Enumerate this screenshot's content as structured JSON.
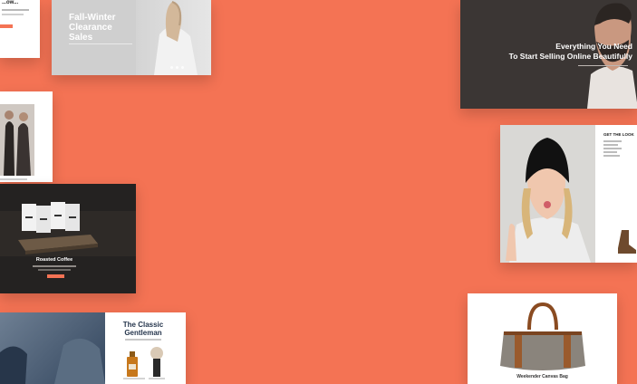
{
  "theme": {
    "background": "#f47354",
    "accent": "#f47354"
  },
  "cards": {
    "topleft": {
      "title": "...ow..."
    },
    "fallwinter": {
      "title": "Fall-Winter Clearance Sales"
    },
    "everything": {
      "headline_line1": "Everything You Need",
      "headline_line2": "To Start Selling Online Beautifully"
    },
    "coffee": {
      "title": "Roasted Coffee"
    },
    "look": {
      "heading": "GET THE LOOK"
    },
    "gentleman": {
      "title": "The Classic Gentleman"
    },
    "bag": {
      "title": "Weekender Canvas Bag"
    }
  }
}
